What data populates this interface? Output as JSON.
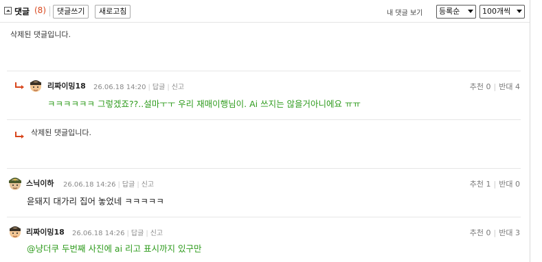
{
  "header": {
    "title": "댓글",
    "count": "(8)",
    "write_btn": "댓글쓰기",
    "refresh_btn": "새로고침",
    "my_comments": "내 댓글 보기",
    "sort_value": "등록순",
    "per_page_value": "100개씩"
  },
  "comments": [
    {
      "deleted_text": "삭제된 댓글입니다."
    },
    {
      "nickname": "리짜이밍18",
      "date": "26.06.18 14:20",
      "reply": "답글",
      "report": "신고",
      "text": "ㅋㅋㅋㅋㅋㅋ 그렇겠죠??..설마ㅜㅜ 우리 재매이행님이. Ai 쓰지는 않을거아니에요 ㅠㅠ",
      "recommend_label": "추천",
      "recommend_count": "0",
      "oppose_label": "반대",
      "oppose_count": "4"
    },
    {
      "deleted_text": "삭제된 댓글입니다."
    },
    {
      "nickname": "스닉이하",
      "date": "26.06.18 14:26",
      "reply": "답글",
      "report": "신고",
      "text": "윤돼지 대가리 집어 놓었네 ㅋㅋㅋㅋㅋ",
      "recommend_label": "추천",
      "recommend_count": "1",
      "oppose_label": "반대",
      "oppose_count": "0"
    },
    {
      "nickname": "리짜이밍18",
      "date": "26.06.18 14:26",
      "reply": "답글",
      "report": "신고",
      "text": "@냥더쿠 두번째 사진에 ai 리고 표시까지 있구만",
      "recommend_label": "추천",
      "recommend_count": "0",
      "oppose_label": "반대",
      "oppose_count": "3"
    }
  ],
  "colors": {
    "accent": "#d8451b",
    "green_text": "#2e9b1c"
  }
}
